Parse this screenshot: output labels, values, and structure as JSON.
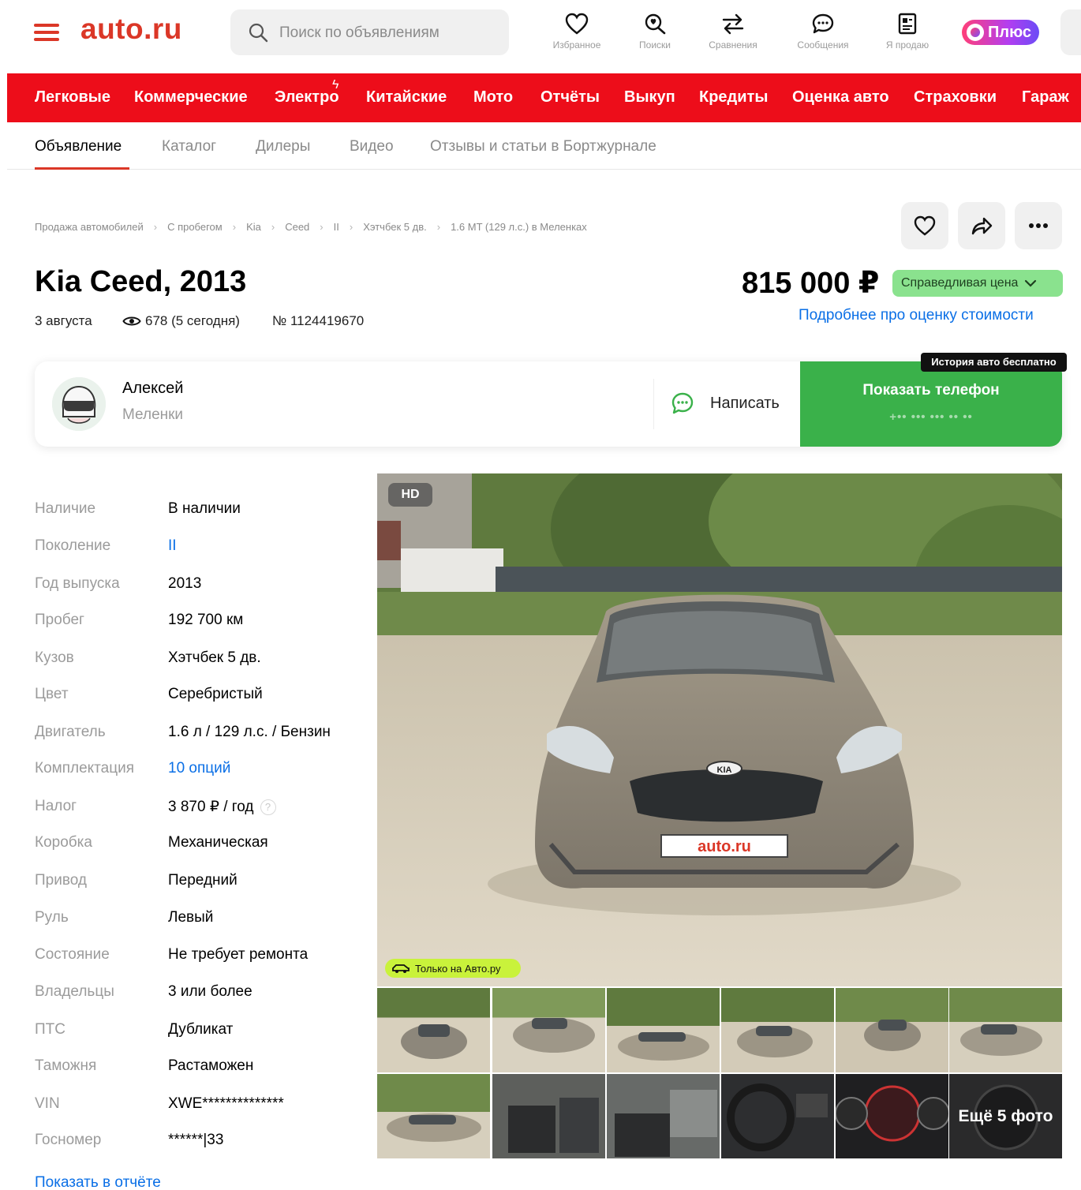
{
  "header": {
    "logo": "auto.ru",
    "search_placeholder": "Поиск по объявлениям",
    "nav": [
      {
        "label": "Избранное",
        "icon": "heart-icon"
      },
      {
        "label": "Поиски",
        "icon": "saved-search-icon"
      },
      {
        "label": "Сравнения",
        "icon": "compare-icon"
      },
      {
        "label": "Сообщения",
        "icon": "chat-icon"
      },
      {
        "label": "Я продаю",
        "icon": "sell-icon"
      }
    ],
    "plus_label": "Плюс"
  },
  "categories": [
    "Легковые",
    "Коммерческие",
    "Электро",
    "Китайские",
    "Мото",
    "Отчёты",
    "Выкуп",
    "Кредиты",
    "Оценка авто",
    "Страховки",
    "Гараж"
  ],
  "subnav": [
    "Объявление",
    "Каталог",
    "Дилеры",
    "Видео",
    "Отзывы и статьи в Бортжурнале"
  ],
  "breadcrumbs": [
    "Продажа автомобилей",
    "С пробегом",
    "Kia",
    "Ceed",
    "II",
    "Хэтчбек 5 дв.",
    "1.6 MT (129 л.с.) в Меленках"
  ],
  "listing": {
    "title": "Kia Ceed, 2013",
    "date": "3 августа",
    "views": "678 (5 сегодня)",
    "number": "№ 1124419670",
    "price": "815 000 ₽",
    "price_badge": "Справедливая цена",
    "price_link": "Подробнее про оценку стоимости"
  },
  "seller": {
    "name": "Алексей",
    "city": "Меленки",
    "write_label": "Написать",
    "phone_label": "Показать телефон",
    "phone_mask": "+•• ••• ••• •• ••",
    "history_badge": "История авто бесплатно"
  },
  "specs": [
    {
      "label": "Наличие",
      "value": "В наличии"
    },
    {
      "label": "Поколение",
      "value": "II",
      "link": true
    },
    {
      "label": "Год выпуска",
      "value": "2013"
    },
    {
      "label": "Пробег",
      "value": "192 700 км"
    },
    {
      "label": "Кузов",
      "value": "Хэтчбек 5 дв."
    },
    {
      "label": "Цвет",
      "value": "Серебристый"
    },
    {
      "label": "Двигатель",
      "value": "1.6 л / 129 л.с. / Бензин"
    },
    {
      "label": "Комплектация",
      "value": "10 опций",
      "link": true
    },
    {
      "label": "Налог",
      "value": "3 870 ₽ / год"
    },
    {
      "label": "Коробка",
      "value": "Механическая"
    },
    {
      "label": "Привод",
      "value": "Передний"
    },
    {
      "label": "Руль",
      "value": "Левый"
    },
    {
      "label": "Состояние",
      "value": "Не требует ремонта"
    },
    {
      "label": "Владельцы",
      "value": "3 или более"
    },
    {
      "label": "ПТС",
      "value": "Дубликат"
    },
    {
      "label": "Таможня",
      "value": "Растаможен"
    },
    {
      "label": "VIN",
      "value": "XWE**************"
    },
    {
      "label": "Госномер",
      "value": "******|33"
    }
  ],
  "report_link": "Показать в отчёте",
  "gallery": {
    "hd_badge": "HD",
    "only_badge": "Только на Авто.ру",
    "plate_text": "auto.ru",
    "brand_emblem": "KIA",
    "more_photos": "Ещё 5 фото"
  },
  "colors": {
    "brand_red": "#db3727",
    "category_red": "#ed0d1a",
    "phone_green": "#3ab14a",
    "fair_price_green": "#8ae28e",
    "link_blue": "#0a6fe6"
  }
}
